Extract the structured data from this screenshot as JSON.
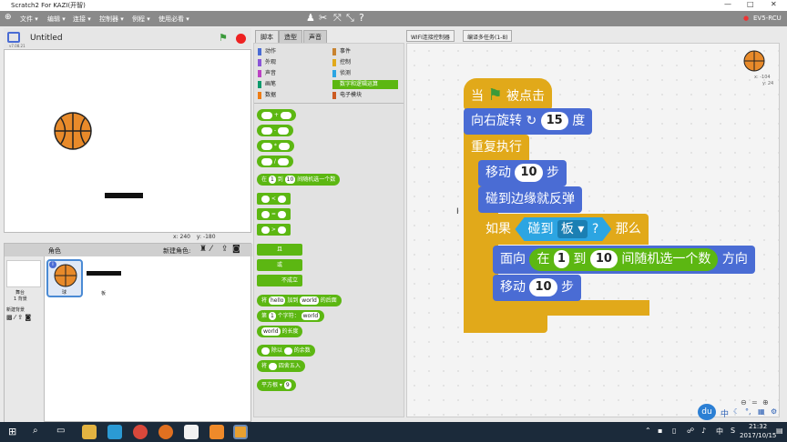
{
  "window": {
    "title": "Scratch2 For KAZI(开智)",
    "user": "EV5-RCU"
  },
  "menu": {
    "items": [
      "文件 ▾",
      "编辑 ▾",
      "连接 ▾",
      "控制器 ▾",
      "例程 ▾",
      "使用必看 ▾"
    ]
  },
  "stage": {
    "project_name": "Untitled",
    "version": "v7.08.21",
    "x_label": "x:",
    "x_val": "240",
    "y_label": "y:",
    "y_val": "-180"
  },
  "sprites": {
    "header": "角色",
    "new_sprite": "新建角色:",
    "stage_label": "舞台",
    "stage_count": "1 背景",
    "new_backdrop": "新建背景",
    "items": [
      "球",
      "板"
    ]
  },
  "tabs": [
    "脚本",
    "造型",
    "声音"
  ],
  "buttons": {
    "wifi": "WIFI连接控制器",
    "multi": "编译多任务(1-8)"
  },
  "categories": [
    {
      "label": "动作",
      "color": "#4a6cd4"
    },
    {
      "label": "事件",
      "color": "#c88330"
    },
    {
      "label": "外观",
      "color": "#8a55d7"
    },
    {
      "label": "控制",
      "color": "#e1a91a"
    },
    {
      "label": "声音",
      "color": "#bb42c3"
    },
    {
      "label": "侦测",
      "color": "#2ca5e2"
    },
    {
      "label": "画笔",
      "color": "#0e9a6c"
    },
    {
      "label": "数字和逻辑运算",
      "color": "#5cb712"
    },
    {
      "label": "数据",
      "color": "#ee7d16"
    },
    {
      "label": "电子模块",
      "color": "#cc5b22"
    }
  ],
  "palette": {
    "ops": [
      "+",
      "-",
      "*",
      "/"
    ],
    "random": {
      "pre": "在",
      "a": "1",
      "mid": "到",
      "b": "10",
      "post": "间随机选一个数"
    },
    "compare": [
      "<",
      "=",
      ">"
    ],
    "logic": [
      "且",
      "或",
      "不成立"
    ],
    "join": {
      "pre": "将",
      "a": "hello",
      "mid": "加到",
      "b": "world",
      "post": "的后面"
    },
    "letter": {
      "pre": "第",
      "a": "1",
      "mid": "个字符：",
      "b": "world"
    },
    "length": {
      "a": "world",
      "post": "的长度"
    },
    "mod": {
      "mid": "除以",
      "post": "的余数"
    },
    "round": {
      "pre": "将",
      "post": "四舍五入"
    },
    "sqrt": {
      "label": "平方根",
      "a": "9"
    }
  },
  "script": {
    "hat": "当",
    "hat_post": "被点击",
    "turn_pre": "向右旋转",
    "turn_val": "15",
    "turn_post": "度",
    "repeat": "重复执行",
    "move_pre": "移动",
    "move_val": "10",
    "move_post": "步",
    "bounce": "碰到边缘就反弹",
    "if_pre": "如果",
    "touch_pre": "碰到",
    "touch_val": "板",
    "touch_q": "?",
    "if_post": "那么",
    "face_pre": "面向",
    "face_rand_pre": "在",
    "face_a": "1",
    "face_mid": "到",
    "face_b": "10",
    "face_rand_post": "间随机选一个数",
    "face_post": "方向",
    "move2_pre": "移动",
    "move2_val": "10",
    "move2_post": "步"
  },
  "sprite_info": {
    "x": "x: -104",
    "y": "y: 24"
  },
  "taskbar": {
    "time": "21:32",
    "date": "2017/10/15",
    "ime": "中"
  }
}
